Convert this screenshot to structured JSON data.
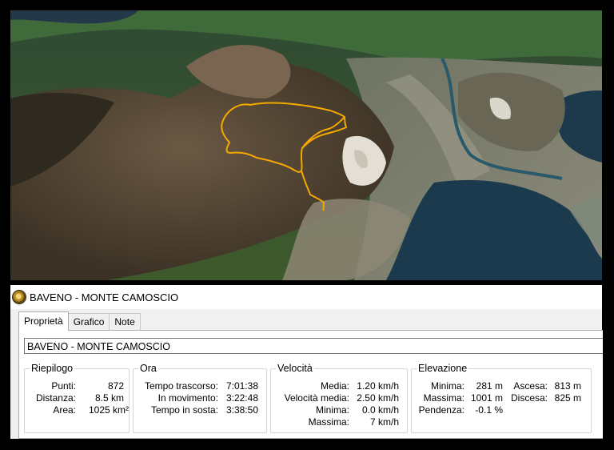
{
  "window": {
    "title": "BAVENO - MONTE CAMOSCIO"
  },
  "tabs": [
    {
      "label": "Proprietà",
      "active": true
    },
    {
      "label": "Grafico",
      "active": false
    },
    {
      "label": "Note",
      "active": false
    }
  ],
  "track_name": "BAVENO - MONTE CAMOSCIO",
  "riepilogo": {
    "title": "Riepilogo",
    "rows": [
      {
        "label": "Punti:",
        "value": "872"
      },
      {
        "label": "Distanza:",
        "value": "8.5 km"
      },
      {
        "label": "Area:",
        "value": "1025 km²"
      }
    ]
  },
  "ora": {
    "title": "Ora",
    "rows": [
      {
        "label": "Tempo trascorso:",
        "value": "7:01:38"
      },
      {
        "label": "In movimento:",
        "value": "3:22:48"
      },
      {
        "label": "Tempo in sosta:",
        "value": "3:38:50"
      }
    ]
  },
  "velocita": {
    "title": "Velocità",
    "rows": [
      {
        "label": "Media:",
        "value": "1.20 km/h"
      },
      {
        "label": "Velocità media:",
        "value": "2.50 km/h"
      },
      {
        "label": "Minima:",
        "value": "0.0 km/h"
      },
      {
        "label": "Massima:",
        "value": "7 km/h"
      }
    ]
  },
  "elevazione": {
    "title": "Elevazione",
    "left_rows": [
      {
        "label": "Minima:",
        "value": "281 m"
      },
      {
        "label": "Massima:",
        "value": "1001 m"
      },
      {
        "label": "Pendenza:",
        "value": "-0.1 %"
      }
    ],
    "right_rows": [
      {
        "label": "Ascesa:",
        "value": "813 m"
      },
      {
        "label": "Discesa:",
        "value": "825 m"
      }
    ]
  },
  "colors": {
    "track": "#f5a900",
    "lake": "#1b3a4e",
    "panel_bg": "#f0f0f0"
  }
}
